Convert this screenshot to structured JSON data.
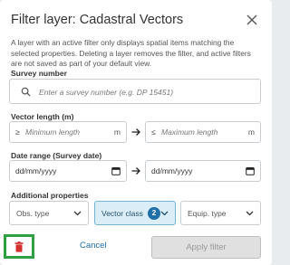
{
  "dialog": {
    "title": "Filter layer: Cadastral Vectors",
    "description": "A layer with an active filter only displays spatial items matching the selected properties. Deleting a layer removes the filter, and active filters are not saved as part of your default view."
  },
  "survey": {
    "label": "Survey number",
    "placeholder": "Enter a survey number (e.g. DP 15451)"
  },
  "vector_length": {
    "label": "Vector length (m)",
    "min_prefix": "≥",
    "min_placeholder": "Minimum length",
    "max_prefix": "≤",
    "max_placeholder": "Maximum length",
    "unit": "m"
  },
  "date_range": {
    "label": "Date range (Survey date)",
    "from_value": "dd/mm/yyyy",
    "to_value": "dd/mm/yyyy"
  },
  "additional": {
    "label": "Additional properties",
    "obs_type": "Obs. type",
    "vector_class": "Vector class",
    "vector_class_count": "2",
    "equip_type": "Equip. type"
  },
  "footer": {
    "cancel": "Cancel",
    "apply": "Apply filter"
  },
  "colors": {
    "accent": "#1f6fa8",
    "highlight_border": "#2ea043",
    "delete_icon": "#d32f2f"
  },
  "icons": [
    "close-icon",
    "search-icon",
    "arrow-right-icon",
    "calendar-icon",
    "chevron-down-icon",
    "trash-icon"
  ]
}
